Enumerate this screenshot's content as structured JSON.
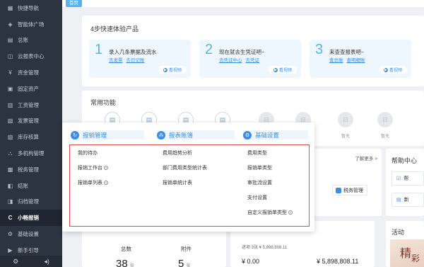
{
  "sidebar": {
    "items": [
      {
        "label": "快捷导航",
        "icon": "grid-icon"
      },
      {
        "label": "智能体广场",
        "icon": "diamond-icon"
      },
      {
        "label": "总账",
        "icon": "ledger-icon"
      },
      {
        "label": "云报表中心",
        "icon": "chart-icon"
      },
      {
        "label": "资金管理",
        "icon": "money-icon"
      },
      {
        "label": "固定资产",
        "icon": "asset-icon"
      },
      {
        "label": "工资管理",
        "icon": "salary-icon"
      },
      {
        "label": "发票管理",
        "icon": "invoice-icon"
      },
      {
        "label": "库存核算",
        "icon": "inventory-icon"
      },
      {
        "label": "多机构管理",
        "icon": "org-icon"
      },
      {
        "label": "税务管理",
        "icon": "tax-icon"
      },
      {
        "label": "结账",
        "icon": "checkout-icon"
      },
      {
        "label": "归档管理",
        "icon": "archive-icon"
      },
      {
        "label": "小畅报销",
        "icon": "reimburse-icon",
        "active": true
      },
      {
        "label": "基础设置",
        "icon": "settings-icon"
      },
      {
        "label": "新手引导",
        "icon": "guide-icon"
      }
    ]
  },
  "tabs": {
    "home": "首页"
  },
  "steps": {
    "title": "4步快速体验产品",
    "view_label": "看视频",
    "items": [
      {
        "num": "1",
        "text": "录入几条票据及流水",
        "links": [
          "去发票",
          "去日记账"
        ]
      },
      {
        "num": "2",
        "text": "现在就去生凭证吧~",
        "links": [
          "去凭证中心",
          "去凭证"
        ]
      },
      {
        "num": "3",
        "text": "来查查报表吧~",
        "links": [
          "查总账",
          "查明细账"
        ]
      }
    ]
  },
  "common": {
    "title": "常用功能",
    "empty_label": "暂无"
  },
  "learn_more": "了解更多 >",
  "tax_chip": "税务管理",
  "help": {
    "title": "帮助中心",
    "items": [
      "帮",
      "新"
    ]
  },
  "stats": {
    "total_label": "总数",
    "total_value": "38",
    "attach_label": "附件",
    "attach_value": "5",
    "unit": "张",
    "note": "进项 3张  ¥ 5,898,808.11",
    "money_left": "¥ 0.00",
    "money_right": "¥ 5,898,808.11"
  },
  "activity": {
    "title": "活动",
    "art_text": "精",
    "art_text2": "彩"
  },
  "popup": {
    "groups": [
      {
        "title": "报销管理",
        "color": "#3a8ee6",
        "items": [
          {
            "label": "我的待办",
            "help": false
          },
          {
            "label": "报销工作台",
            "help": true
          },
          {
            "label": "报销单列表",
            "help": true
          }
        ]
      },
      {
        "title": "报表账簿",
        "color": "#3a8ee6",
        "items": [
          {
            "label": "费用趋势分析",
            "help": false
          },
          {
            "label": "部门费用类型统计表",
            "help": false
          },
          {
            "label": "报销单统计表",
            "help": false
          }
        ]
      },
      {
        "title": "基础设置",
        "color": "#3a8ee6",
        "items": [
          {
            "label": "费用类型",
            "help": false
          },
          {
            "label": "报销单类型",
            "help": false
          },
          {
            "label": "审批流设置",
            "help": false
          },
          {
            "label": "支付设置",
            "help": false
          },
          {
            "label": "自定义报销单类型",
            "help": true
          }
        ]
      }
    ]
  }
}
